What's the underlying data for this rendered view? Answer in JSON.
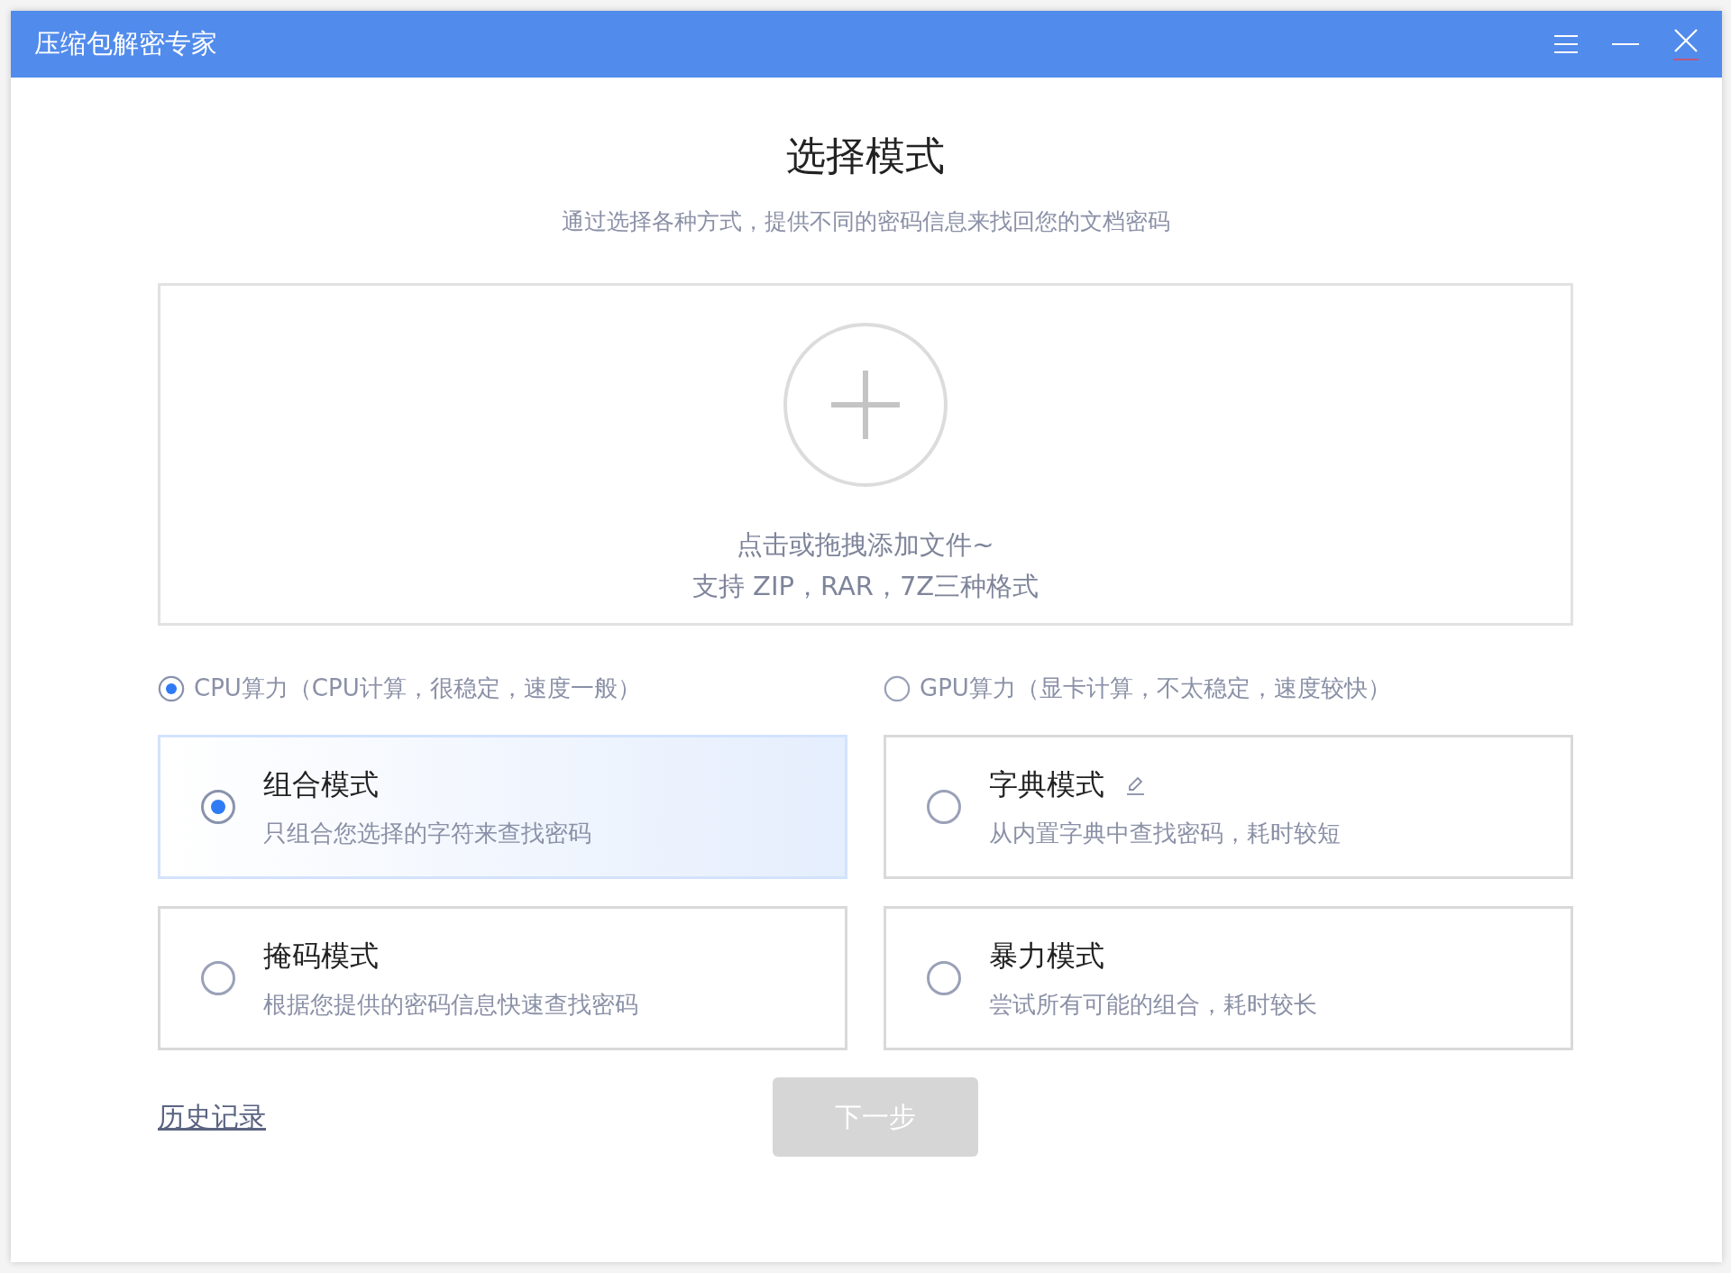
{
  "window": {
    "title": "压缩包解密专家"
  },
  "heading": "选择模式",
  "subtitle": "通过选择各种方式，提供不同的密码信息来找回您的文档密码",
  "drop_zone": {
    "lines": [
      "点击或拖拽添加文件~",
      "支持 ZIP，RAR，7Z三种格式"
    ]
  },
  "compute_options": [
    {
      "label": "CPU算力（CPU计算，很稳定，速度一般）",
      "selected": true
    },
    {
      "label": "GPU算力（显卡计算，不太稳定，速度较快）",
      "selected": false
    }
  ],
  "modes": [
    {
      "title": "组合模式",
      "description": "只组合您选择的字符来查找密码",
      "selected": true,
      "editable": false
    },
    {
      "title": "字典模式",
      "description": "从内置字典中查找密码，耗时较短",
      "selected": false,
      "editable": true
    },
    {
      "title": "掩码模式",
      "description": "根据您提供的密码信息快速查找密码",
      "selected": false,
      "editable": false
    },
    {
      "title": "暴力模式",
      "description": "尝试所有可能的组合，耗时较长",
      "selected": false,
      "editable": false
    }
  ],
  "history_link": "历史记录",
  "next_button": {
    "label": "下一步",
    "disabled": true
  }
}
